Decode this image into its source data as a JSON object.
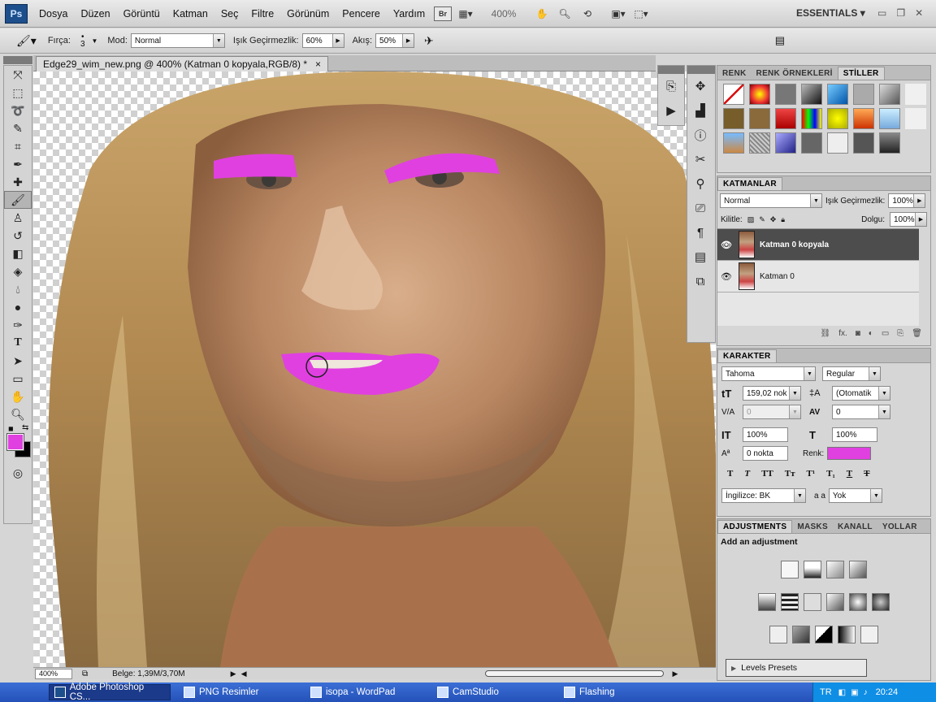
{
  "app": {
    "logo": "Ps"
  },
  "menu": [
    "Dosya",
    "Düzen",
    "Görüntü",
    "Katman",
    "Seç",
    "Filtre",
    "Görünüm",
    "Pencere",
    "Yardım"
  ],
  "toolbar": {
    "bridge": "Br",
    "zoom": "400%",
    "workspace": "ESSENTIALS"
  },
  "options": {
    "brush_label": "Fırça:",
    "brush_size": "3",
    "mode_label": "Mod:",
    "mode_value": "Normal",
    "opacity_label": "Işık Geçirmezlik:",
    "opacity_value": "60%",
    "flow_label": "Akış:",
    "flow_value": "50%"
  },
  "document": {
    "tab_title": "Edge29_wim_new.png @ 400% (Katman 0 kopyala,RGB/8) *",
    "close": "×"
  },
  "status": {
    "zoom": "400%",
    "doc_size": "Belge: 1,39M/3,70M"
  },
  "styles_panel": {
    "tabs": [
      "RENK",
      "RENK ÖRNEKLERİ",
      "STİLLER"
    ],
    "active": 2
  },
  "layers_panel": {
    "title": "KATMANLAR",
    "blend": "Normal",
    "opacity_label": "Işık Geçirmezlik:",
    "opacity_value": "100%",
    "lock_label": "Kilitle:",
    "fill_label": "Dolgu:",
    "fill_value": "100%",
    "layers": [
      {
        "name": "Katman 0 kopyala",
        "selected": true
      },
      {
        "name": "Katman 0",
        "selected": false
      }
    ]
  },
  "character_panel": {
    "title": "KARAKTER",
    "font": "Tahoma",
    "style": "Regular",
    "size": "159,02 nok",
    "leading": "(Otomatik",
    "kerning": "0",
    "tracking": "0",
    "vscale": "100%",
    "hscale": "100%",
    "baseline": "0 nokta",
    "color_label": "Renk:",
    "color": "#e040e0",
    "language": "İngilizce: BK",
    "aa_label": "a a",
    "aa_value": "Yok"
  },
  "adjustments_panel": {
    "tabs": [
      "ADJUSTMENTS",
      "MASKS",
      "KANALL",
      "YOLLAR"
    ],
    "subtitle": "Add an adjustment",
    "preset": "Levels Presets"
  },
  "taskbar": {
    "items": [
      "Adobe Photoshop CS...",
      "PNG Resimler",
      "isopa - WordPad",
      "CamStudio",
      "Flashing"
    ],
    "lang": "TR",
    "time": "20:24"
  },
  "colors": {
    "foreground": "#e040e0",
    "background": "#000000"
  }
}
